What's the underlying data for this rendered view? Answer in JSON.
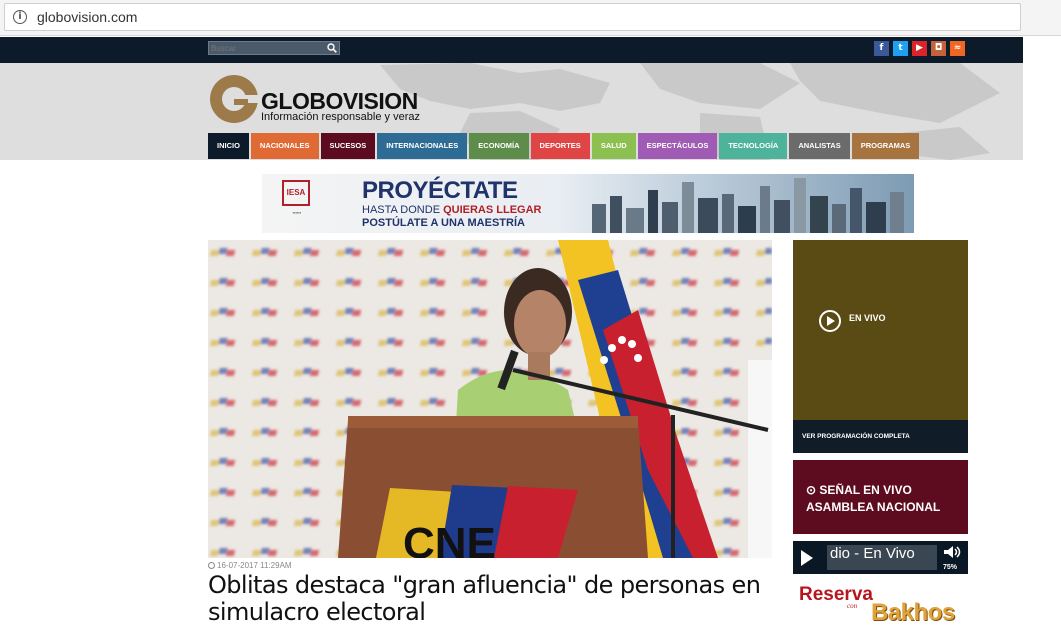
{
  "browser": {
    "url": "globovision.com"
  },
  "topbar": {
    "search_placeholder": "Buscar",
    "social": [
      {
        "icon": "facebook-icon",
        "glyph": "f",
        "color": "#3b5998"
      },
      {
        "icon": "twitter-icon",
        "glyph": "t",
        "color": "#1da1f2"
      },
      {
        "icon": "youtube-icon",
        "glyph": "▶",
        "color": "#d9252a"
      },
      {
        "icon": "instagram-icon",
        "glyph": "◘",
        "color": "#c4623b"
      },
      {
        "icon": "rss-icon",
        "glyph": "≈",
        "color": "#f26522"
      }
    ]
  },
  "header": {
    "logo_name": "GLOBOVISION",
    "logo_tagline": "Información responsable y veraz",
    "nav": [
      {
        "label": "INICIO",
        "color": "#0c1a2a"
      },
      {
        "label": "NACIONALES",
        "color": "#e06a34"
      },
      {
        "label": "SUCESOS",
        "color": "#5c0c1e"
      },
      {
        "label": "INTERNACIONALES",
        "color": "#2e6b95"
      },
      {
        "label": "ECONOMÍA",
        "color": "#5e8c4a"
      },
      {
        "label": "DEPORTES",
        "color": "#e04545"
      },
      {
        "label": "SALUD",
        "color": "#8cc152"
      },
      {
        "label": "ESPECTÁCULOS",
        "color": "#a05cb5"
      },
      {
        "label": "TECNOLOGÍA",
        "color": "#4db39b"
      },
      {
        "label": "ANALISTAS",
        "color": "#6b6b6b"
      },
      {
        "label": "PROGRAMAS",
        "color": "#a7733e"
      }
    ]
  },
  "banner": {
    "line1": "PROYÉCTATE",
    "line2a": "HASTA DONDE ",
    "line2b": "QUIERAS LLEGAR",
    "line3": "POSTÚLATE A UNA MAESTRÍA",
    "sponsor": "IESA"
  },
  "article": {
    "date": "16-07-2017 11:29AM",
    "headline": "Oblitas destaca \"gran afluencia\" de personas en simulacro electoral",
    "podium_text": "CNE"
  },
  "sidebar": {
    "live_label": "EN VIVO",
    "live_schedule": "VER PROGRAMACIÓN COMPLETA",
    "senal_line1": "SEÑAL EN VIVO",
    "senal_line2": "ASAMBLEA NACIONAL",
    "player_title": "dio - En Vivo",
    "player_volume": "75%",
    "ad_line1": "Reserva",
    "ad_line2": "con",
    "ad_line3": "Bakhos"
  }
}
